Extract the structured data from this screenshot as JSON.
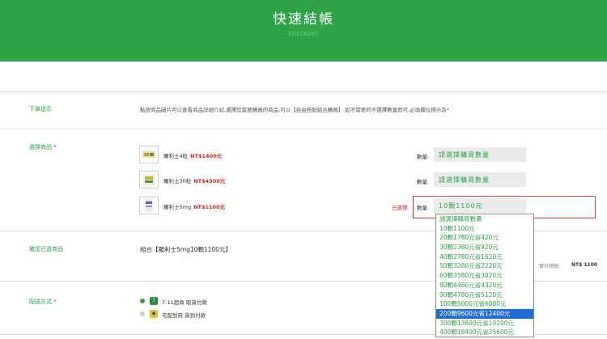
{
  "header": {
    "title": "快速結帳",
    "subtitle": "CHECKOUT"
  },
  "sections": {
    "notice_label": "下單提示",
    "notice_text": "點按商品圖片可以查看商品詳細介紹,選擇您需要購買的商品,可以【自由搭配組合購買】,如不需要的不選擇數量即可,必填欄位標示為",
    "required_mark": "*",
    "products_label": "選擇商品",
    "confirm_label": "確認已選商品",
    "shipping_label": "配送方式"
  },
  "products": [
    {
      "name": "羅利士4粒",
      "price": "NT$1400元",
      "qty_label": "數量:",
      "qty_value": "請選擇購買數量"
    },
    {
      "name": "羅利士30粒",
      "price": "NT$4500元",
      "qty_label": "數量:",
      "qty_value": "請選擇購買數量"
    },
    {
      "name": "羅利士5mg",
      "price": "NT$1100元",
      "qty_label": "數量:",
      "qty_value": "10顆1100元",
      "selected_tag": "已選擇"
    }
  ],
  "dropdown": {
    "options": [
      "請選擇購買數量",
      "10顆1100元",
      "20顆1780元省420元",
      "30顆2380元省920元",
      "40顆2780元省1620元",
      "50顆3280元省2220元",
      "60顆3580元省3020元",
      "80顆4480元省4320元",
      "90顆4780元省5120元",
      "100顆5000元省6000元",
      "200顆9600元省12400元",
      "300顆13800元省19200元",
      "400顆18400元省25600元"
    ],
    "highlighted_index": 10
  },
  "confirm": {
    "text": "組合【羅利士5mg10顆1100元】",
    "total_label": "實付總額:",
    "total_value": "NT$ 1100"
  },
  "shipping": [
    {
      "label": "7-11超商 取貨付款",
      "selected": true,
      "icon": "seven-eleven-icon"
    },
    {
      "label": "宅配到府 貨到付款",
      "selected": false,
      "icon": "delivery-truck-icon"
    }
  ],
  "colors": {
    "brand": "#2ea447",
    "price": "#e02020",
    "highlight": "#1f6fd6"
  }
}
